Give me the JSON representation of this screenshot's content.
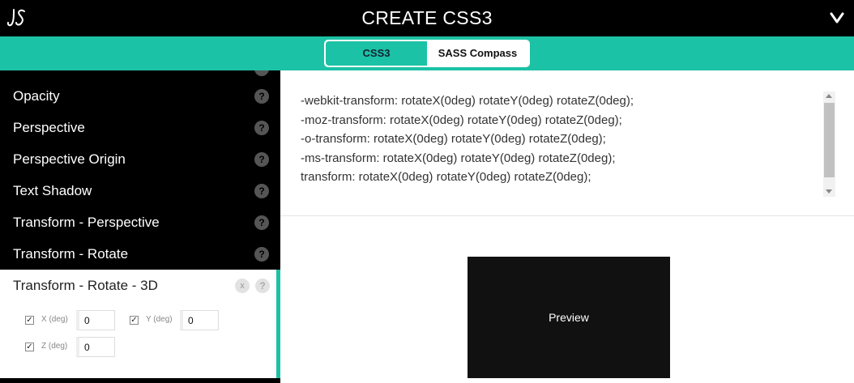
{
  "header": {
    "title": "CREATE CSS3"
  },
  "tabs": [
    {
      "label": "CSS3",
      "active": true
    },
    {
      "label": "SASS Compass",
      "active": false
    }
  ],
  "sidebar": {
    "items": [
      {
        "label": "Opacity"
      },
      {
        "label": "Perspective"
      },
      {
        "label": "Perspective Origin"
      },
      {
        "label": "Text Shadow"
      },
      {
        "label": "Transform - Perspective"
      },
      {
        "label": "Transform - Rotate"
      }
    ],
    "help_symbol": "?",
    "active_item": {
      "label": "Transform - Rotate - 3D",
      "close_symbol": "x",
      "controls": [
        {
          "label": "X (deg)",
          "value": "0",
          "checked": true
        },
        {
          "label": "Y (deg)",
          "value": "0",
          "checked": true
        },
        {
          "label": "Z (deg)",
          "value": "0",
          "checked": true
        }
      ]
    }
  },
  "code": {
    "lines": [
      "-webkit-transform: rotateX(0deg) rotateY(0deg) rotateZ(0deg);",
      "-moz-transform: rotateX(0deg) rotateY(0deg) rotateZ(0deg);",
      "-o-transform: rotateX(0deg) rotateY(0deg) rotateZ(0deg);",
      "-ms-transform: rotateX(0deg) rotateY(0deg) rotateZ(0deg);",
      "transform: rotateX(0deg) rotateY(0deg) rotateZ(0deg);"
    ]
  },
  "preview": {
    "label": "Preview"
  },
  "colors": {
    "accent": "#1cc2a5",
    "header_bg": "#000000",
    "sidebar_bg": "#000000",
    "preview_bg": "#111111"
  }
}
